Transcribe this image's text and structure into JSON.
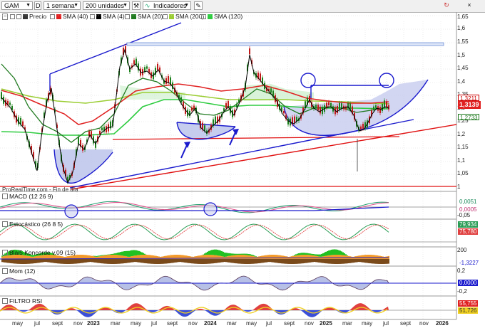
{
  "toolbar": {
    "ticker": "GAM",
    "d_label": "D",
    "period": "1 semana",
    "units": "200 unidades",
    "indicators": "Indicadores"
  },
  "legend": {
    "price": "Precio",
    "sma40": "SMA (40)",
    "sma4": "SMA (4)",
    "sma20": "SMA (20)",
    "sma200": "SMA (200)",
    "sma120": "SMA (120)"
  },
  "price_axis": [
    "1,65",
    "1,6",
    "1,55",
    "1,5",
    "1,45",
    "1,4",
    "1,35",
    "1,3",
    "1,25",
    "1,2",
    "1,15",
    "1,1",
    "1,05",
    "1"
  ],
  "price_badges": {
    "b1": "1,3211",
    "b2": "1,3139",
    "b3": "1,2733"
  },
  "watermark": "ProRealTime.com - Fin de día",
  "panes": {
    "macd": {
      "title": "MACD (12 26 9)",
      "v1": "0,0051",
      "v2": "0,0005",
      "tick": "-0,05"
    },
    "stoch": {
      "title": "Estocástico (26 8 5)",
      "v1": "79,934",
      "v2": "75,780"
    },
    "blai": {
      "title": "Blai5 Koncorde v.09 (15)",
      "top": "200",
      "v1": "-1,3227"
    },
    "mom": {
      "title": "Mom (12)",
      "top": "0,2",
      "v1": "0,0000",
      "bot": "-0,2"
    },
    "rsi": {
      "title": "FILTRO RSI",
      "v1": "55,755",
      "v2": "51,726"
    }
  },
  "x_labels": [
    "may",
    "jul",
    "sept",
    "nov",
    "2023",
    "mar",
    "may",
    "jul",
    "sept",
    "nov",
    "2024",
    "mar",
    "may",
    "jul",
    "sept",
    "nov",
    "2025",
    "mar",
    "may",
    "jul",
    "sept",
    "nov",
    "2026"
  ],
  "colors": {
    "sma40": "#e02020",
    "sma4": "#000000",
    "sma20": "#1f7a1f",
    "sma200": "#9acd32",
    "sma120": "#2ecc40",
    "trend": "#1a1acd"
  }
}
